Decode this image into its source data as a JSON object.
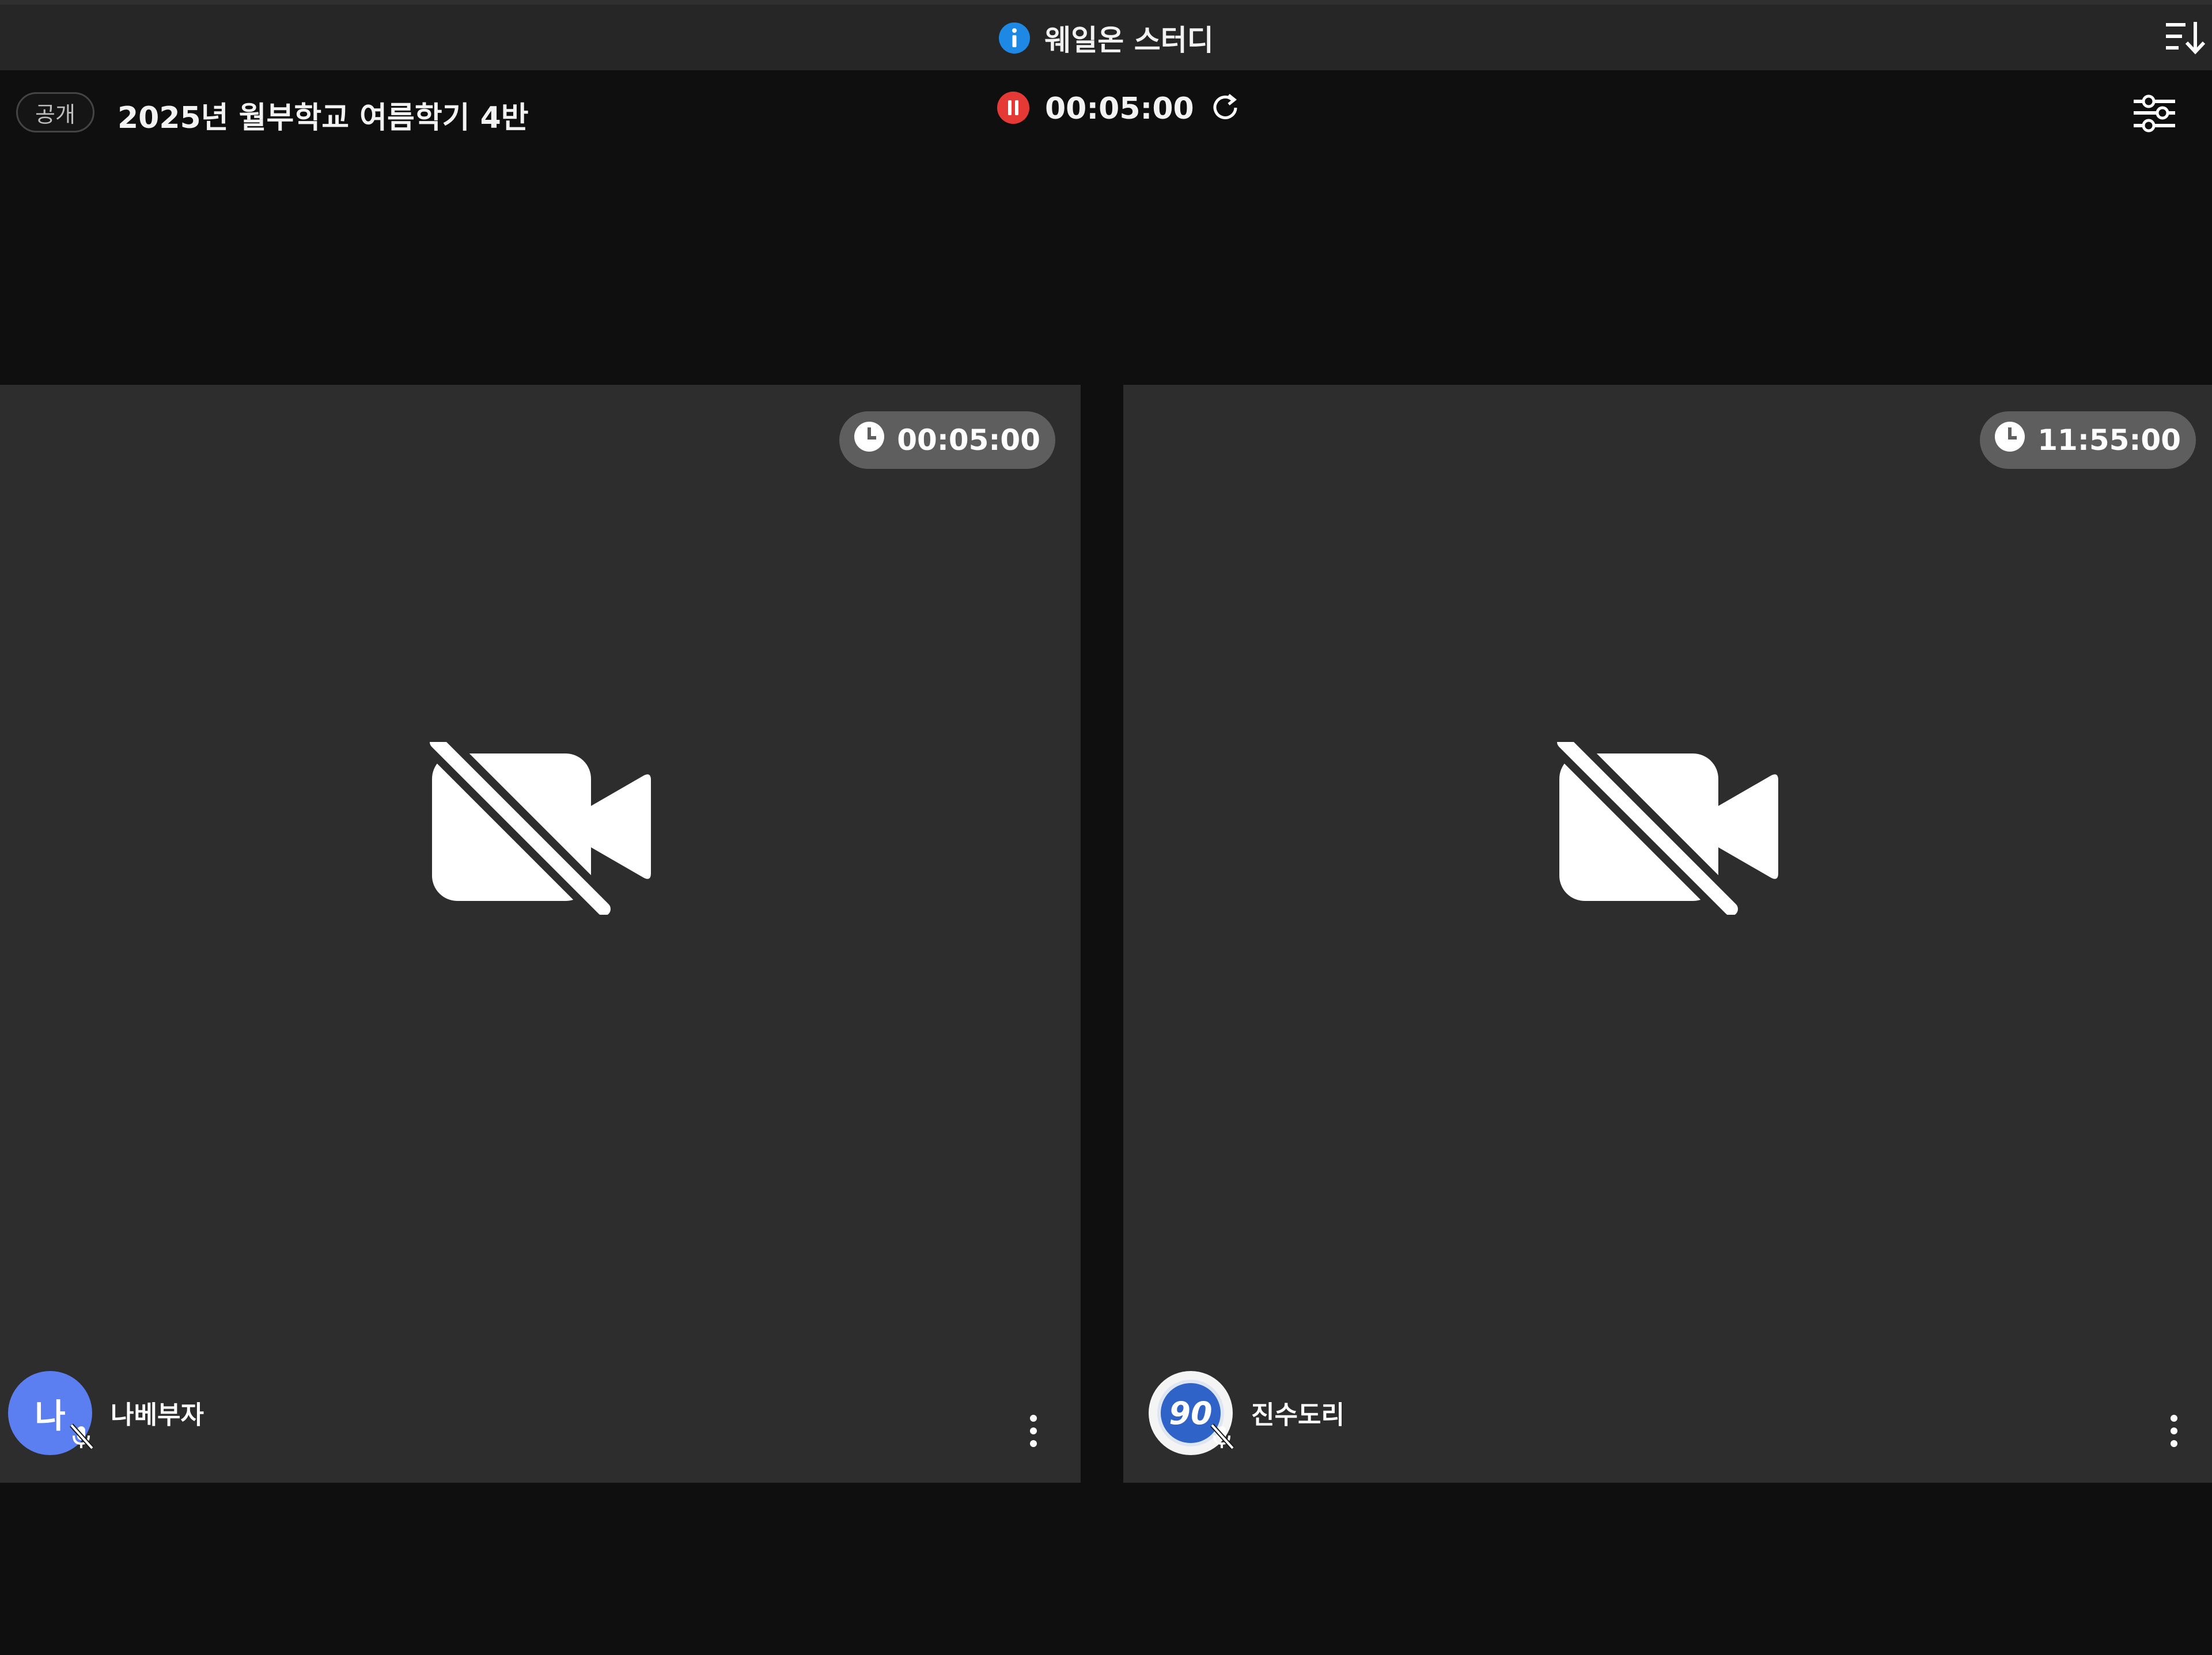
{
  "app": {
    "title": "웨일온 스터디"
  },
  "room": {
    "visibility_badge": "공개",
    "title": "2025년 월부학교 여름학기 4반",
    "timer": "00:05:00"
  },
  "participants": [
    {
      "name": "나베부자",
      "avatar_text": "나",
      "timer": "00:05:00",
      "avatar_color": "#5b7ef0"
    },
    {
      "name": "진수도리",
      "avatar_text": "90",
      "timer": "11:55:00",
      "avatar_color": "#2f63c8"
    }
  ],
  "colors": {
    "accent_blue": "#1e88e5",
    "pause_red": "#e53935",
    "background": "#0f0f0f",
    "tile": "#2d2d2d"
  },
  "icons": [
    "info-icon",
    "sort-icon",
    "pause-icon",
    "refresh-icon",
    "settings-sliders-icon",
    "clock-icon",
    "camera-off-icon",
    "mic-off-icon",
    "more-vertical-icon"
  ]
}
